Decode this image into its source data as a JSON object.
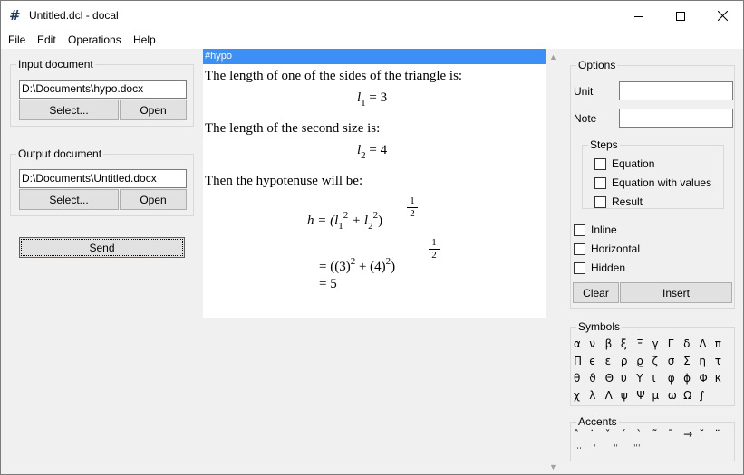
{
  "window": {
    "title": "Untitled.dcl - docal"
  },
  "menu": [
    "File",
    "Edit",
    "Operations",
    "Help"
  ],
  "input_document": {
    "title": "Input document",
    "path": "D:\\Documents\\hypo.docx",
    "select_label": "Select...",
    "open_label": "Open"
  },
  "output_document": {
    "title": "Output document",
    "path": "D:\\Documents\\Untitled.docx",
    "select_label": "Select...",
    "open_label": "Open"
  },
  "send_label": "Send",
  "document": {
    "tag": "#hypo",
    "p1": "The length of one of the sides of the triangle is:",
    "eq1": {
      "var": "l",
      "sub": "1",
      "rest": " = 3"
    },
    "p2": "The length of the second size is:",
    "eq2": {
      "var": "l",
      "sub": "2",
      "rest": " = 4"
    },
    "p3": "Then the hypotenuse will be:",
    "eq3": {
      "lhs": "h = (l",
      "s1": "1",
      "e1": "2",
      "plus": " + l",
      "s2": "2",
      "e2": "2",
      "close": ")",
      "frac_num": "1",
      "frac_den": "2"
    },
    "eq4": {
      "text": "= ((3)",
      "e1": "2",
      "plus": " + (4)",
      "e2": "2",
      "close": ")",
      "frac_num": "1",
      "frac_den": "2"
    },
    "eq5": "= 5"
  },
  "options": {
    "title": "Options",
    "unit_label": "Unit",
    "unit_value": "",
    "note_label": "Note",
    "note_value": "",
    "steps_title": "Steps",
    "steps": [
      "Equation",
      "Equation with values",
      "Result"
    ],
    "flags": [
      "Inline",
      "Horizontal",
      "Hidden"
    ],
    "clear_label": "Clear",
    "insert_label": "Insert"
  },
  "symbols": {
    "title": "Symbols",
    "rows": [
      [
        "α",
        "ν",
        "β",
        "ξ",
        "Ξ",
        "γ",
        "Γ",
        "δ",
        "Δ",
        "π"
      ],
      [
        "Π",
        "ϵ",
        "ε",
        "ρ",
        "ϱ",
        "ζ",
        "σ",
        "Σ",
        "η",
        "τ"
      ],
      [
        "θ",
        "ϑ",
        "Θ",
        "υ",
        "Υ",
        "ι",
        "φ",
        "ϕ",
        "Φ",
        "κ"
      ],
      [
        "χ",
        "λ",
        "Λ",
        "ψ",
        "Ψ",
        "μ",
        "ω",
        "Ω",
        "∫",
        ""
      ]
    ]
  },
  "accents": {
    "title": "Accents",
    "row1": [
      "ˆ",
      "˙",
      "ˇ",
      "´",
      "`",
      "˜",
      "¯",
      "→",
      "˘",
      "¨"
    ],
    "row2": [
      "⋯",
      "ˈ",
      "ˈˈ",
      "ˈˈˈ"
    ]
  },
  "colors": {
    "doc_header": "#3b8ff5",
    "accent": "#0078d7"
  }
}
